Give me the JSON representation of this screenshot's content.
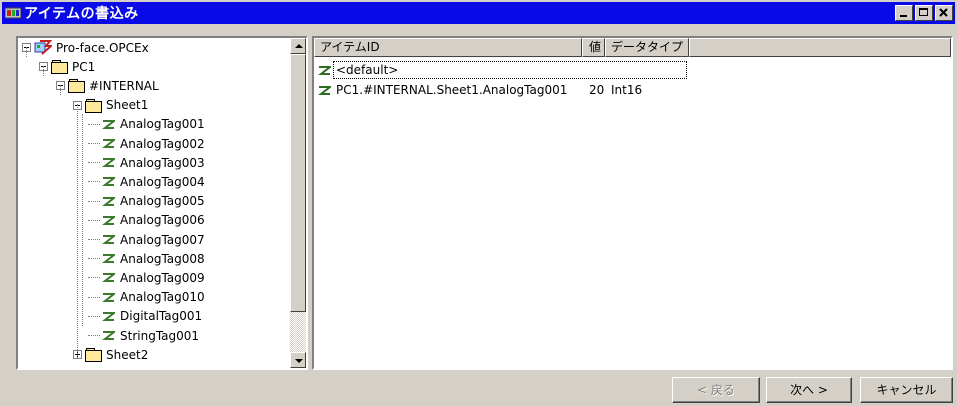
{
  "window": {
    "title": "アイテムの書込み",
    "controls": [
      "minimize",
      "maximize",
      "close"
    ]
  },
  "tree": {
    "items": [
      {
        "label": "Pro-face.OPCEx",
        "icon": "server-icon",
        "expander": "minus"
      },
      {
        "label": "PC1",
        "icon": "folder-icon",
        "expander": "minus"
      },
      {
        "label": "#INTERNAL",
        "icon": "folder-icon",
        "expander": "minus"
      },
      {
        "label": "Sheet1",
        "icon": "folder-icon",
        "expander": "minus"
      },
      {
        "label": "AnalogTag001",
        "icon": "tag-icon"
      },
      {
        "label": "AnalogTag002",
        "icon": "tag-icon"
      },
      {
        "label": "AnalogTag003",
        "icon": "tag-icon"
      },
      {
        "label": "AnalogTag004",
        "icon": "tag-icon"
      },
      {
        "label": "AnalogTag005",
        "icon": "tag-icon"
      },
      {
        "label": "AnalogTag006",
        "icon": "tag-icon"
      },
      {
        "label": "AnalogTag007",
        "icon": "tag-icon"
      },
      {
        "label": "AnalogTag008",
        "icon": "tag-icon"
      },
      {
        "label": "AnalogTag009",
        "icon": "tag-icon"
      },
      {
        "label": "AnalogTag010",
        "icon": "tag-icon"
      },
      {
        "label": "DigitalTag001",
        "icon": "tag-icon"
      },
      {
        "label": "StringTag001",
        "icon": "tag-icon"
      },
      {
        "label": "Sheet2",
        "icon": "folder-icon",
        "expander": "plus"
      }
    ]
  },
  "list": {
    "columns": [
      "アイテムID",
      "値",
      "データタイプ"
    ],
    "rows": [
      {
        "id": "<default>",
        "value": "",
        "type": ""
      },
      {
        "id": "PC1.#INTERNAL.Sheet1.AnalogTag001",
        "value": "20",
        "type": "Int16"
      }
    ]
  },
  "buttons": {
    "back": "< 戻る",
    "next": "次へ >",
    "cancel": "キャンセル"
  },
  "colors": {
    "titlebar": "#0a0ae6",
    "face": "#d4d0c8",
    "tag_icon": "#3a7a2a"
  }
}
